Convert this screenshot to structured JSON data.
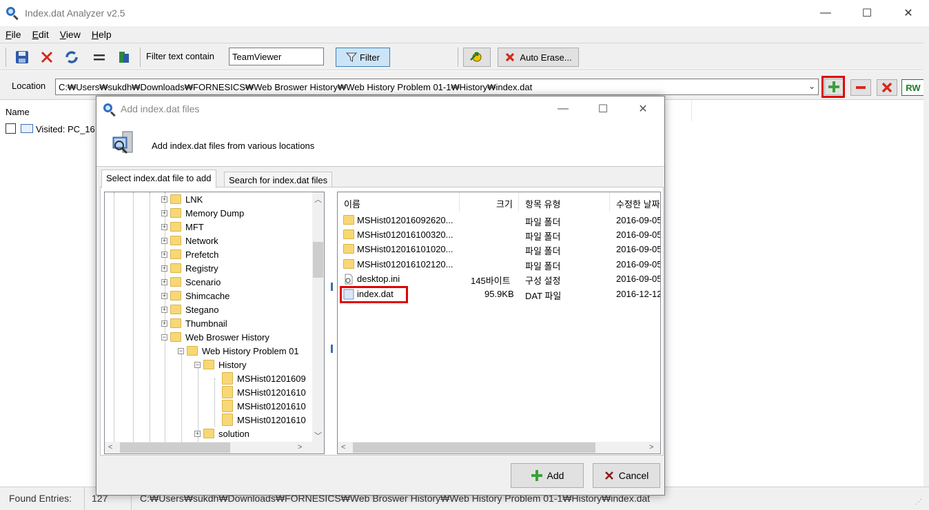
{
  "app": {
    "title": "Index.dat Analyzer v2.5"
  },
  "window_controls": {
    "minimize": "—",
    "maximize": "☐",
    "close": "✕"
  },
  "menu": [
    {
      "label": "File",
      "key": "F",
      "rest": "ile"
    },
    {
      "label": "Edit",
      "key": "E",
      "rest": "dit"
    },
    {
      "label": "View",
      "key": "V",
      "rest": "iew"
    },
    {
      "label": "Help",
      "key": "H",
      "rest": "elp"
    }
  ],
  "toolbar": {
    "filter_label": "Filter text contain",
    "filter_value": "TeamViewer",
    "filter_button": "Filter",
    "auto_erase_button": "Auto Erase..."
  },
  "location": {
    "label": "Location",
    "path": "C:₩Users₩sukdh₩Downloads₩FORNESICS₩Web Broswer History₩Web History Problem 01-1₩History₩index.dat",
    "rw_label": "RW"
  },
  "list": {
    "column_name": "Name",
    "rows": [
      {
        "text": "Visited: PC_16"
      }
    ]
  },
  "status": {
    "found_label": "Found Entries:",
    "found_count": "127",
    "path": "C:₩Users₩sukdh₩Downloads₩FORNESICS₩Web Broswer History₩Web History Problem 01-1₩History₩index.dat"
  },
  "dialog": {
    "title": "Add index.dat files",
    "header_text": "Add index.dat files from various locations",
    "tabs": [
      "Select index.dat file to add",
      "Search for index.dat files"
    ],
    "tree": [
      {
        "label": "LNK",
        "level": 0,
        "toggle": "+"
      },
      {
        "label": "Memory Dump",
        "level": 0,
        "toggle": "+"
      },
      {
        "label": "MFT",
        "level": 0,
        "toggle": "+"
      },
      {
        "label": "Network",
        "level": 0,
        "toggle": "+"
      },
      {
        "label": "Prefetch",
        "level": 0,
        "toggle": "+"
      },
      {
        "label": "Registry",
        "level": 0,
        "toggle": "+"
      },
      {
        "label": "Scenario",
        "level": 0,
        "toggle": "+"
      },
      {
        "label": "Shimcache",
        "level": 0,
        "toggle": "+"
      },
      {
        "label": "Stegano",
        "level": 0,
        "toggle": "+"
      },
      {
        "label": "Thumbnail",
        "level": 0,
        "toggle": "+"
      },
      {
        "label": "Web Broswer History",
        "level": 0,
        "toggle": "−"
      },
      {
        "label": "Web History Problem 01",
        "level": 1,
        "toggle": "−"
      },
      {
        "label": "History",
        "level": 2,
        "toggle": "−"
      },
      {
        "label": "MSHist01201609",
        "level": 3,
        "toggle": ""
      },
      {
        "label": "MSHist01201610",
        "level": 3,
        "toggle": ""
      },
      {
        "label": "MSHist01201610",
        "level": 3,
        "toggle": ""
      },
      {
        "label": "MSHist01201610",
        "level": 3,
        "toggle": ""
      },
      {
        "label": "solution",
        "level": 2,
        "toggle": "+"
      }
    ],
    "file_columns": [
      "이름",
      "크기",
      "항목 유형",
      "수정한 날짜"
    ],
    "files": [
      {
        "name": "MSHist012016092620...",
        "size": "",
        "type": "파일 폴더",
        "date": "2016-09-05",
        "icon": "folder-icon"
      },
      {
        "name": "MSHist012016100320...",
        "size": "",
        "type": "파일 폴더",
        "date": "2016-09-05",
        "icon": "folder-icon"
      },
      {
        "name": "MSHist012016101020...",
        "size": "",
        "type": "파일 폴더",
        "date": "2016-09-05",
        "icon": "folder-icon"
      },
      {
        "name": "MSHist012016102120...",
        "size": "",
        "type": "파일 폴더",
        "date": "2016-09-05",
        "icon": "folder-icon"
      },
      {
        "name": "desktop.ini",
        "size": "145바이트",
        "type": "구성 설정",
        "date": "2016-09-05",
        "icon": "settings-file-icon"
      },
      {
        "name": "index.dat",
        "size": "95.9KB",
        "type": "DAT 파일",
        "date": "2016-12-12",
        "icon": "dat-file-icon"
      }
    ],
    "add_button": "Add",
    "cancel_button": "Cancel"
  },
  "colors": {
    "highlight": "#e00000",
    "accent": "#3b6db5",
    "folder": "#f8d775"
  }
}
